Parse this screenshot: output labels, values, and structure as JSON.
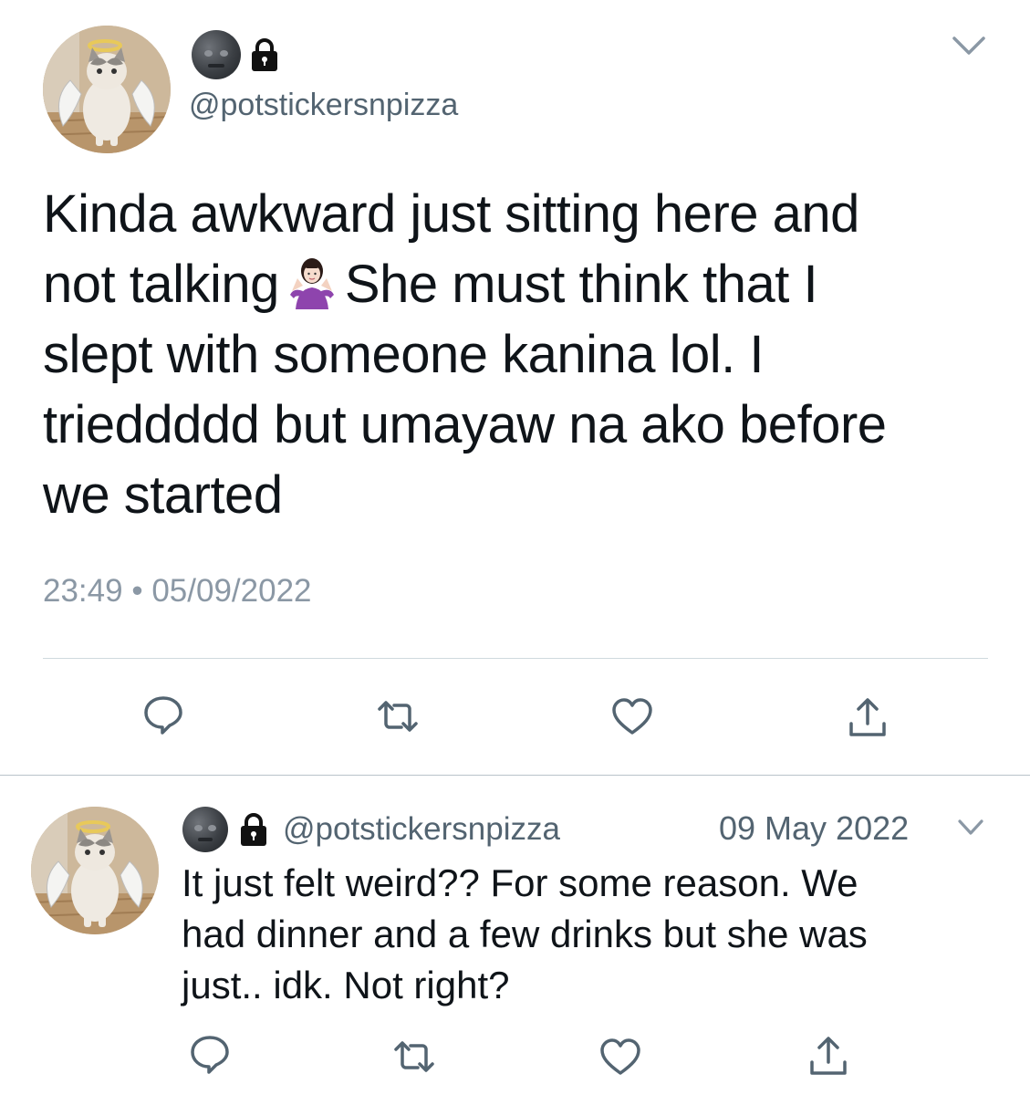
{
  "main_tweet": {
    "handle": "@potstickersnpizza",
    "text_line_1": "Kinda awkward just sitting here and",
    "text_line_2a": "not talking",
    "text_line_2b": "She must think that I",
    "text_line_3": "slept with someone kanina lol. I",
    "text_line_4": "trieddddd but umayaw na ako before",
    "text_line_5": "we started",
    "time": "23:49",
    "separator": "•",
    "date": "05/09/2022"
  },
  "reply_tweet": {
    "handle": "@potstickersnpizza",
    "date": "09 May 2022",
    "text_line_1": "It just felt weird?? For some reason. We",
    "text_line_2": "had dinner and a few drinks but she was",
    "text_line_3": "just.. idk. Not right?"
  },
  "icons": {
    "display_name_emoji": "new-moon-face-emoji",
    "protected": "lock-icon",
    "inline_emoji": "person-shrugging-emoji",
    "menu": "chevron-down-icon",
    "actions": [
      "reply-icon",
      "retweet-icon",
      "like-icon",
      "share-icon"
    ]
  },
  "colors": {
    "text": "#0f1419",
    "secondary": "#536471",
    "timestamp": "#8b98a5",
    "divider": "#cfd9de",
    "icon": "#536471"
  }
}
